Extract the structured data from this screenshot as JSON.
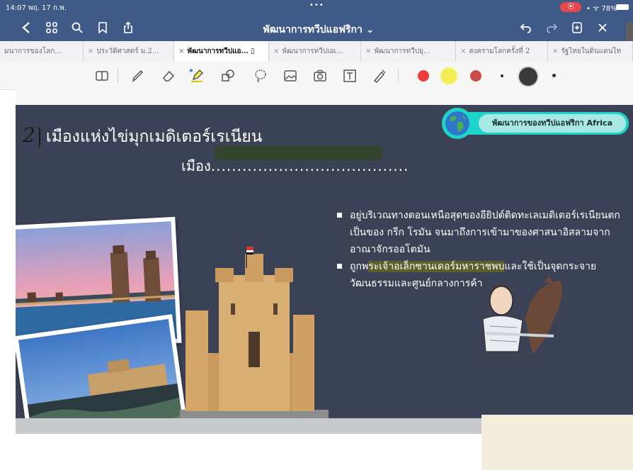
{
  "status": {
    "time": "14:07  พฤ. 17 ก.พ.",
    "dots": "•••",
    "record": "⦿",
    "battery": "• ᯤ 78%"
  },
  "nav": {
    "title": "พัฒนาการทวีปแอฟริกา ⌄",
    "back_icon": "chevron-left-icon",
    "grid_icon": "grid-icon",
    "search_icon": "search-icon",
    "bookmark_icon": "bookmark-icon",
    "share_icon": "share-icon",
    "undo_icon": "undo-icon",
    "redo_icon": "redo-icon",
    "add_page_icon": "add-page-icon",
    "close_icon": "close-icon"
  },
  "tabs": [
    {
      "label": "มนาการของโลก...",
      "active": false
    },
    {
      "label": "ประวัติศาสตร์ ม.2...",
      "active": false
    },
    {
      "label": "พัฒนาการทวีปแอ...",
      "active": true
    },
    {
      "label": "พัฒนาการทวีปเอเ...",
      "active": false
    },
    {
      "label": "พัฒนาการทวีปยุ...",
      "active": false
    },
    {
      "label": "สงครามโลกครั้งที่ 2",
      "active": false
    },
    {
      "label": "รัฐไทยในดินแดนไท",
      "active": false
    }
  ],
  "toolbar": {
    "colors": {
      "red": "#ee3b3e",
      "yellow": "#f3ec52",
      "darkred": "#cd4a4a",
      "black": "#303030"
    },
    "icons": [
      "reader-icon",
      "pen-icon",
      "eraser-icon",
      "highlighter-icon",
      "shapes-icon",
      "lasso-icon",
      "image-icon",
      "camera-icon",
      "textbox-icon",
      "pointer-icon"
    ]
  },
  "slide": {
    "number": "2",
    "title": "เมืองแห่งไข่มุกเมดิเตอร์เรเนียน",
    "subline_prefix": "เมือง",
    "subline_dots": "......................................",
    "badge": "พัฒนาการของทวีปแอฟริกา Africa",
    "bullet1": "อยู่บริเวณทางตอนเหนือสุดของอียิปต์ติดทะเลเมดิเตอร์เรเนียนตก เป็นของ กรีก โรมัน จนมาถึงการเข้ามาของศาสนาอิสลามจาก อาณาจักรออโตมัน",
    "bullet2_pre": "ถูกพ",
    "bullet2_hl": "ระเจ้าอเล็กซานเดอร์มหาราชพบ",
    "bullet2_post": "และใช้เป็นจุดกระจาย วัฒนธรรมและศูนย์กลางการค้า"
  },
  "colors": {
    "topbar": "#3f5a86",
    "slide_bg": "#3b4256",
    "badge": "#1ed3c7"
  }
}
